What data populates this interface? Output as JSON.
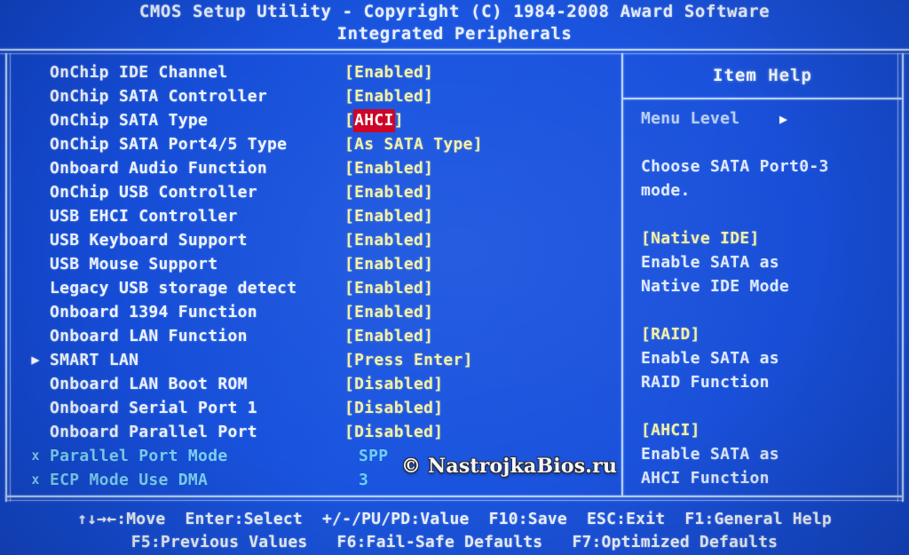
{
  "header": {
    "line1": "CMOS Setup Utility - Copyright (C) 1984-2008 Award Software",
    "line2": "Integrated Peripherals"
  },
  "settings": [
    {
      "marker": "",
      "label": "OnChip IDE Channel",
      "value_prefix": "[",
      "value_hl": "",
      "value_text": "Enabled",
      "value_suffix": "]",
      "dim": false
    },
    {
      "marker": "",
      "label": "OnChip SATA Controller",
      "value_prefix": "[",
      "value_hl": "",
      "value_text": "Enabled",
      "value_suffix": "]",
      "dim": false
    },
    {
      "marker": "",
      "label": "OnChip SATA Type",
      "value_prefix": "[",
      "value_hl": "AHCI",
      "value_text": "",
      "value_suffix": "]",
      "dim": false
    },
    {
      "marker": "",
      "label": "OnChip SATA Port4/5 Type",
      "value_prefix": "[",
      "value_hl": "",
      "value_text": "As SATA Type",
      "value_suffix": "]",
      "dim": false
    },
    {
      "marker": "",
      "label": "Onboard Audio Function",
      "value_prefix": "[",
      "value_hl": "",
      "value_text": "Enabled",
      "value_suffix": "]",
      "dim": false
    },
    {
      "marker": "",
      "label": "OnChip USB Controller",
      "value_prefix": "[",
      "value_hl": "",
      "value_text": "Enabled",
      "value_suffix": "]",
      "dim": false
    },
    {
      "marker": "",
      "label": "USB EHCI Controller",
      "value_prefix": "[",
      "value_hl": "",
      "value_text": "Enabled",
      "value_suffix": "]",
      "dim": false
    },
    {
      "marker": "",
      "label": "USB Keyboard Support",
      "value_prefix": "[",
      "value_hl": "",
      "value_text": "Enabled",
      "value_suffix": "]",
      "dim": false
    },
    {
      "marker": "",
      "label": "USB Mouse Support",
      "value_prefix": "[",
      "value_hl": "",
      "value_text": "Enabled",
      "value_suffix": "]",
      "dim": false
    },
    {
      "marker": "",
      "label": "Legacy USB storage detect",
      "value_prefix": "[",
      "value_hl": "",
      "value_text": "Enabled",
      "value_suffix": "]",
      "dim": false
    },
    {
      "marker": "",
      "label": "Onboard 1394 Function",
      "value_prefix": "[",
      "value_hl": "",
      "value_text": "Enabled",
      "value_suffix": "]",
      "dim": false
    },
    {
      "marker": "",
      "label": "Onboard LAN Function",
      "value_prefix": "[",
      "value_hl": "",
      "value_text": "Enabled",
      "value_suffix": "]",
      "dim": false
    },
    {
      "marker": "▶",
      "label": "SMART LAN",
      "value_prefix": "[",
      "value_hl": "",
      "value_text": "Press Enter",
      "value_suffix": "]",
      "dim": false
    },
    {
      "marker": "",
      "label": "Onboard LAN Boot ROM",
      "value_prefix": "[",
      "value_hl": "",
      "value_text": "Disabled",
      "value_suffix": "]",
      "dim": false
    },
    {
      "marker": "",
      "label": "Onboard Serial Port 1",
      "value_prefix": "[",
      "value_hl": "",
      "value_text": "Disabled",
      "value_suffix": "]",
      "dim": false
    },
    {
      "marker": "",
      "label": "Onboard Parallel Port",
      "value_prefix": "[",
      "value_hl": "",
      "value_text": "Disabled",
      "value_suffix": "]",
      "dim": false
    },
    {
      "marker": "x",
      "label": "Parallel Port Mode",
      "value_prefix": "",
      "value_hl": "",
      "value_text": "SPP",
      "value_suffix": "",
      "dim": true
    },
    {
      "marker": "x",
      "label": "ECP Mode Use DMA",
      "value_prefix": "",
      "value_hl": "",
      "value_text": "3",
      "value_suffix": "",
      "dim": true
    }
  ],
  "item_help": {
    "title": "Item Help",
    "menu_level_label": "Menu Level",
    "menu_level_arrow": "▶",
    "lines": [
      {
        "text": "Choose SATA Port0-3",
        "style": "bright"
      },
      {
        "text": "mode.",
        "style": "bright"
      },
      {
        "text": "",
        "style": "blank"
      },
      {
        "text": "[Native IDE]",
        "style": "accent"
      },
      {
        "text": "Enable SATA as",
        "style": "bright"
      },
      {
        "text": "Native IDE Mode",
        "style": "bright"
      },
      {
        "text": "",
        "style": "blank"
      },
      {
        "text": "[RAID]",
        "style": "accent"
      },
      {
        "text": "Enable SATA as",
        "style": "bright"
      },
      {
        "text": "RAID Function",
        "style": "bright"
      },
      {
        "text": "",
        "style": "blank"
      },
      {
        "text": "[AHCI]",
        "style": "accent"
      },
      {
        "text": "Enable SATA as",
        "style": "bright"
      },
      {
        "text": "AHCI Function",
        "style": "bright"
      }
    ]
  },
  "footer": {
    "line1": "↑↓→←:Move  Enter:Select  +/-/PU/PD:Value  F10:Save  ESC:Exit  F1:General Help",
    "line2": "F5:Previous Values   F6:Fail-Safe Defaults   F7:Optimized Defaults"
  },
  "watermark": {
    "text": "© NastrojkaBios.ru"
  },
  "colors": {
    "background": "#1a55e0",
    "label": "#eef4ff",
    "value": "#f2f0a8",
    "highlight": "#cc0022",
    "dimmed": "#7fd4f5",
    "border": "#b9d2ff"
  }
}
